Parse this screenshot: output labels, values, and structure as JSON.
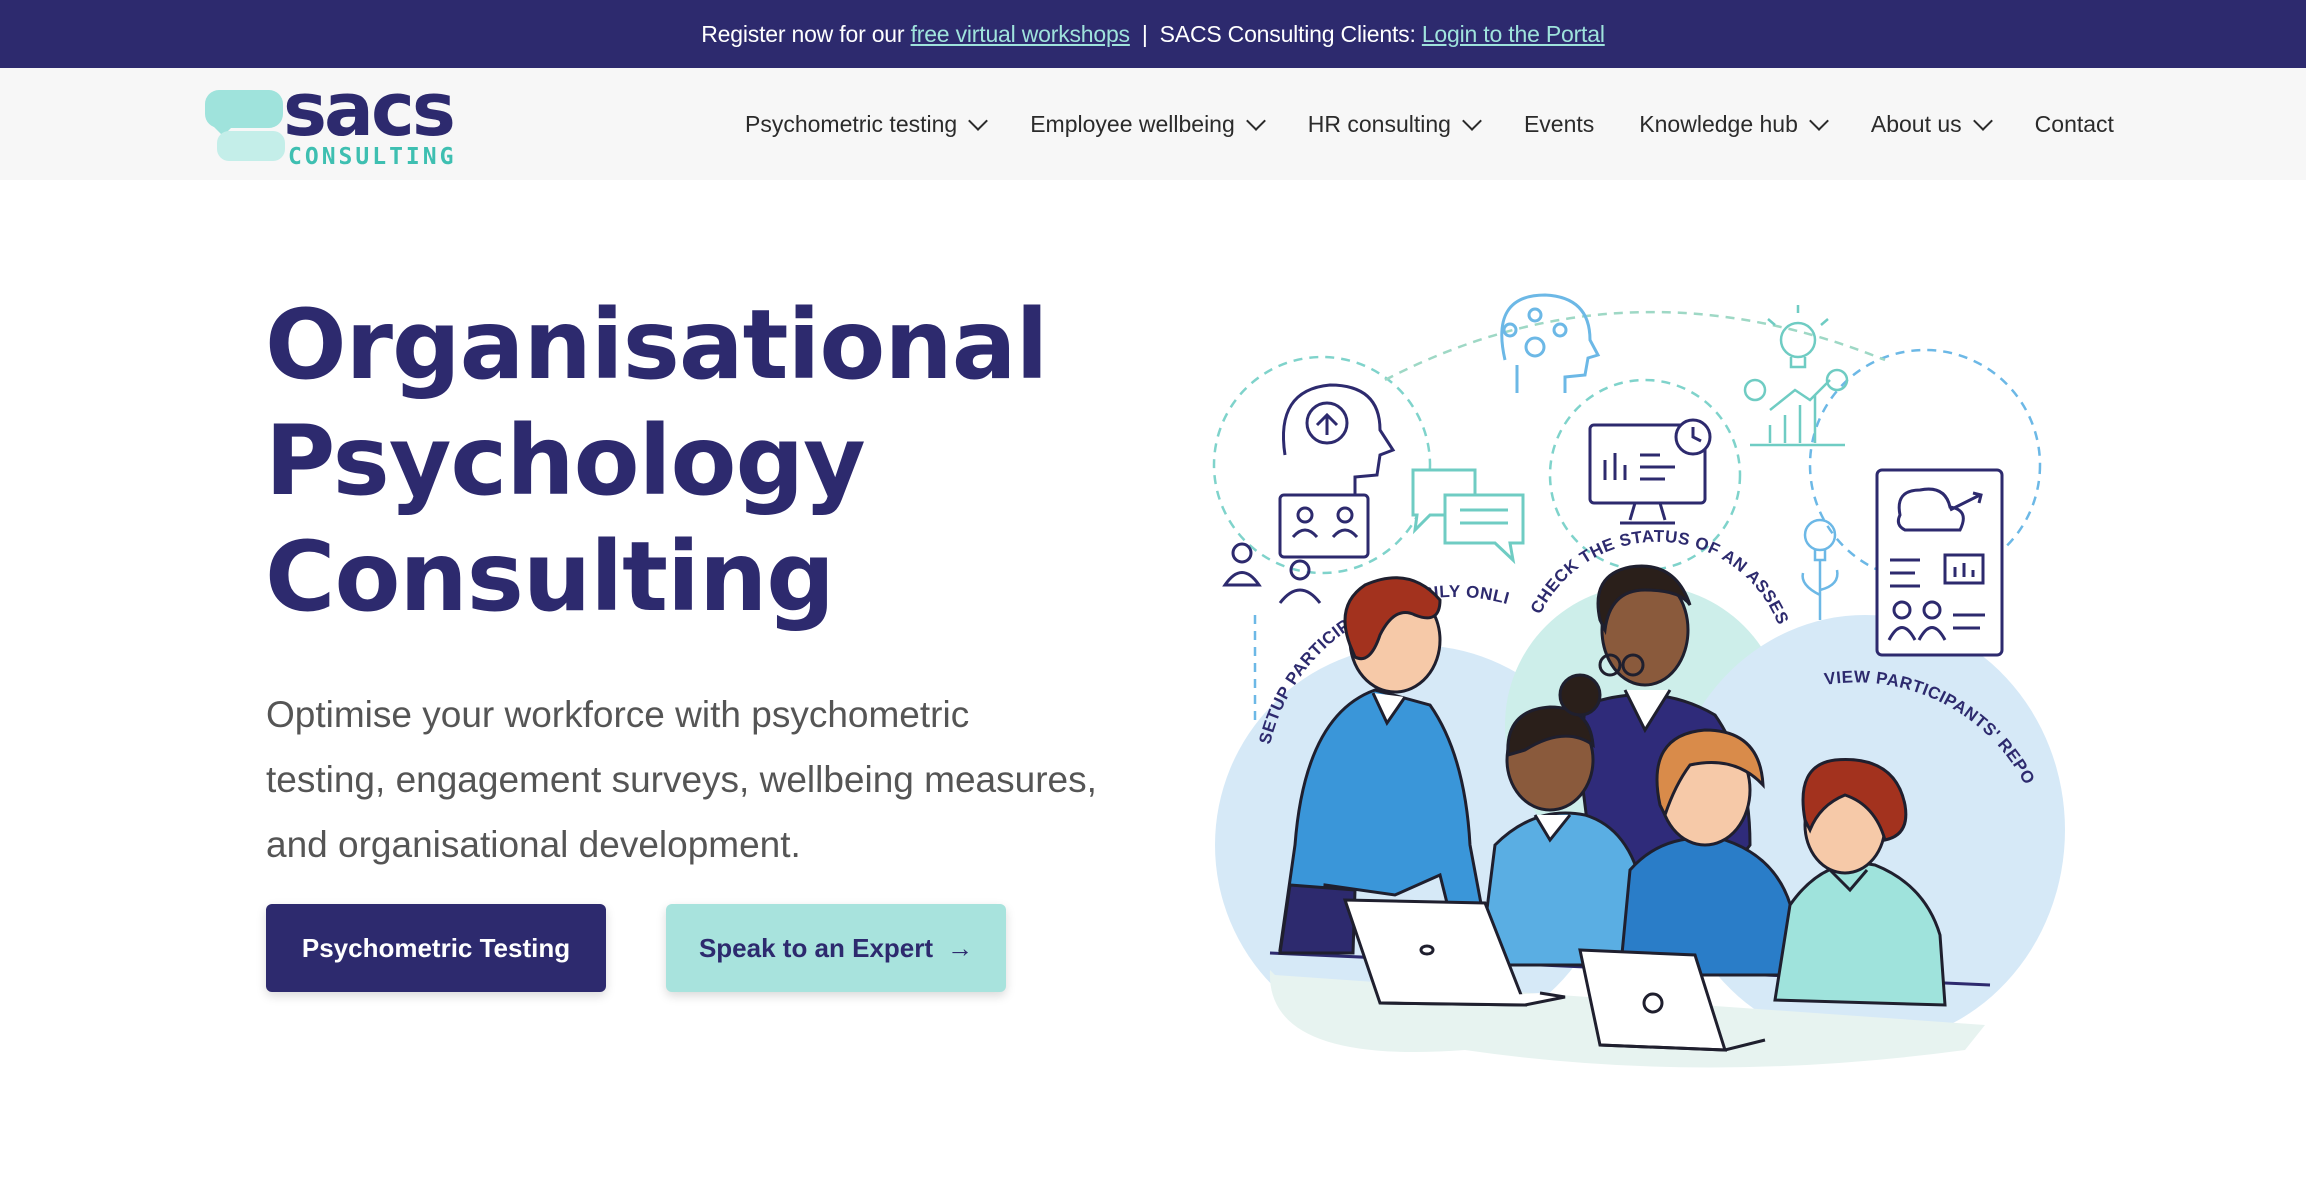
{
  "topbar": {
    "text_prefix": "Register now for our",
    "workshops_link": "free virtual workshops",
    "separator": "|",
    "clients_text": "SACS Consulting Clients:",
    "portal_link": "Login to the Portal"
  },
  "logo": {
    "word": "sacs",
    "sub": "CONSULTING"
  },
  "nav": {
    "items": [
      {
        "label": "Psychometric testing",
        "has_dropdown": true
      },
      {
        "label": "Employee wellbeing",
        "has_dropdown": true
      },
      {
        "label": "HR consulting",
        "has_dropdown": true
      },
      {
        "label": "Events",
        "has_dropdown": false
      },
      {
        "label": "Knowledge hub",
        "has_dropdown": true
      },
      {
        "label": "About us",
        "has_dropdown": true
      },
      {
        "label": "Contact",
        "has_dropdown": false
      }
    ]
  },
  "hero": {
    "title_lines": [
      "Organisational",
      "Psychology",
      "Consulting"
    ],
    "description_lines": [
      "Optimise your workforce with psychometric",
      "testing, engagement surveys, wellbeing measures,",
      "and organisational development."
    ],
    "primary_button": "Psychometric Testing",
    "secondary_button": "Speak to an Expert",
    "secondary_button_icon": "arrow-right-icon"
  },
  "illustration": {
    "labels": {
      "setup": "SETUP PARTICIPANTS EASILY ONLINE",
      "status": "CHECK THE STATUS OF AN ASSESSMENT",
      "reports": "VIEW PARTICIPANTS' REPORTS"
    }
  },
  "colors": {
    "brand_navy": "#2d2a6e",
    "brand_teal": "#9fe3dc",
    "accent_teal_text": "#3ebfb1",
    "nav_bg": "#f7f7f7",
    "light_blue": "#d6e9f7"
  }
}
